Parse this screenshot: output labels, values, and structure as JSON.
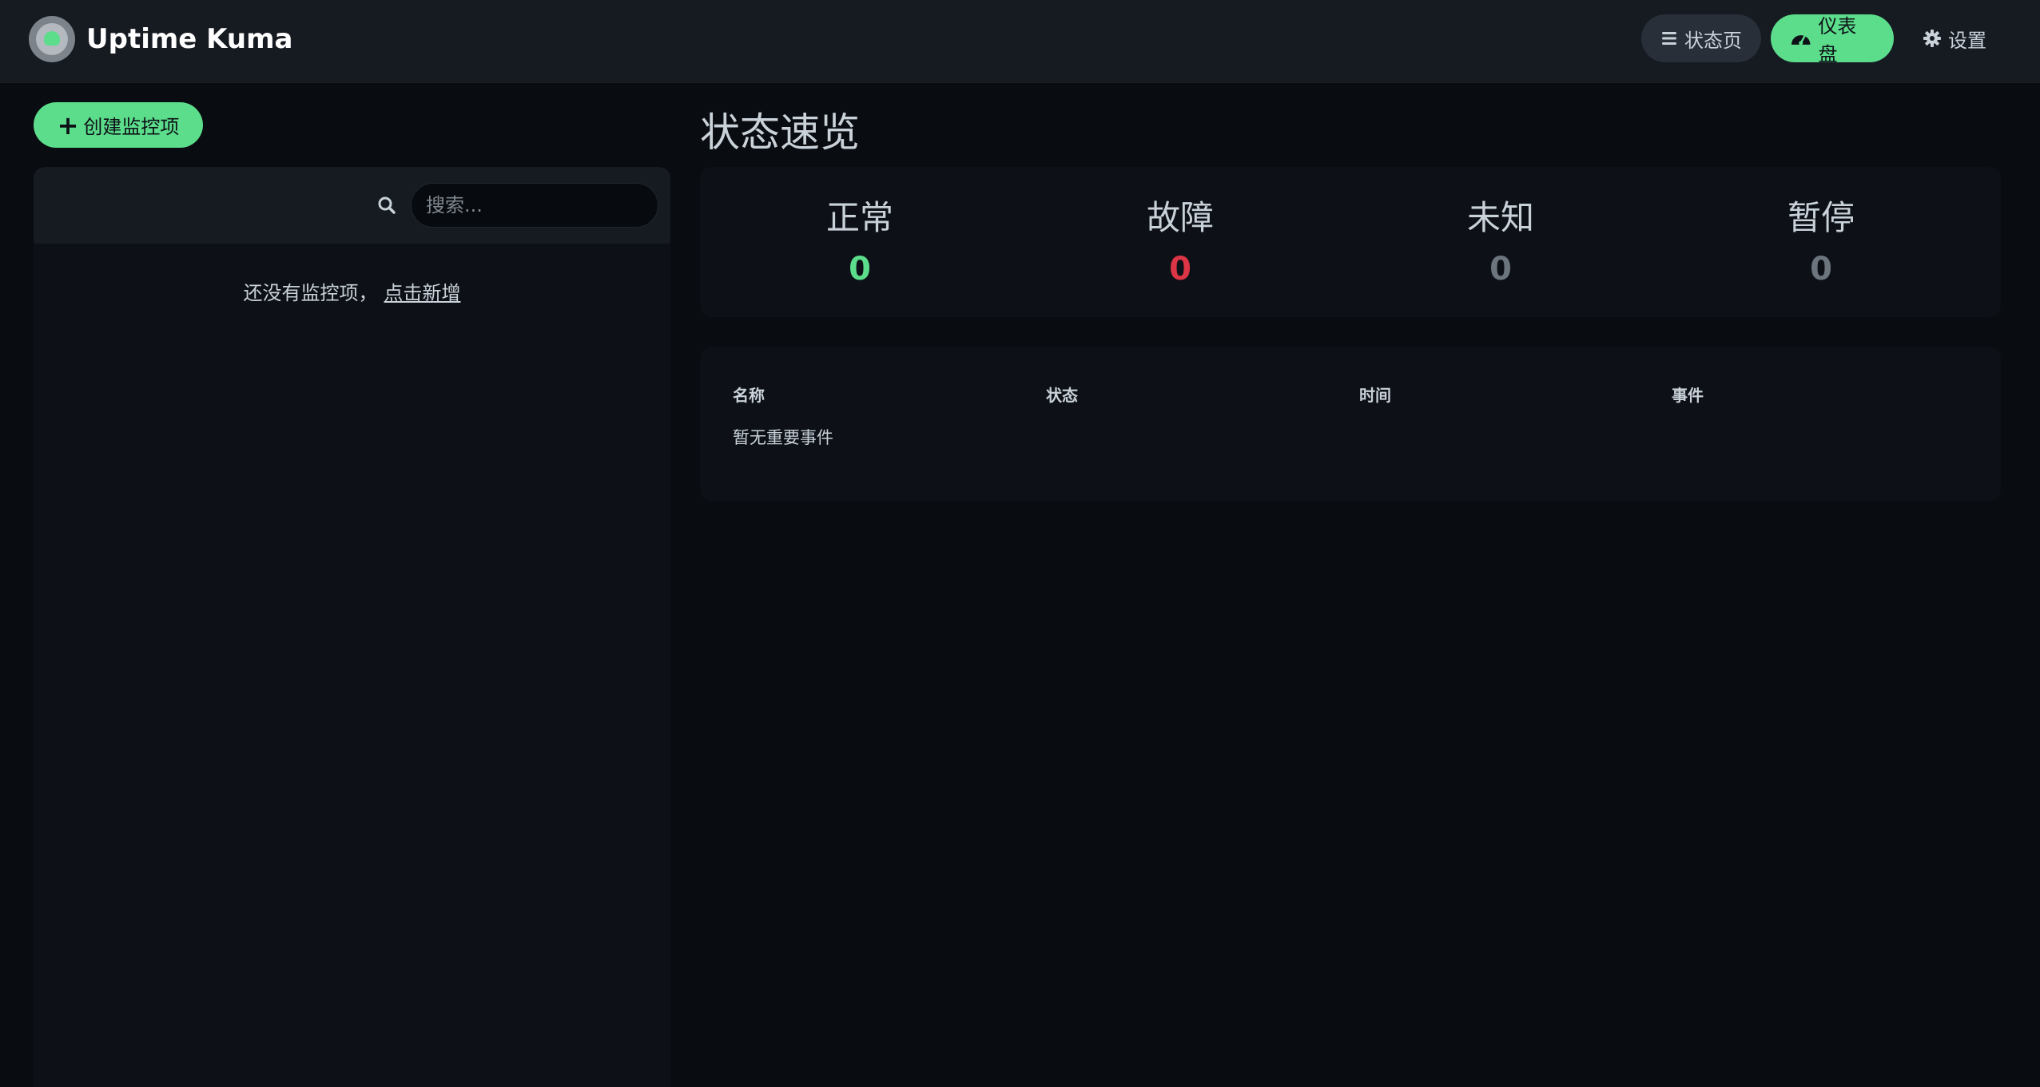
{
  "brand": {
    "name": "Uptime Kuma"
  },
  "nav": {
    "status_page": "状态页",
    "dashboard": "仪表盘",
    "settings": "设置"
  },
  "sidebar": {
    "create_button": "创建监控项",
    "search_placeholder": "搜索...",
    "empty_text": "还没有监控项，",
    "empty_link": "点击新增"
  },
  "main": {
    "title": "状态速览",
    "stats": [
      {
        "label": "正常",
        "value": "0",
        "color": "#5cdd8b"
      },
      {
        "label": "故障",
        "value": "0",
        "color": "#dc3545"
      },
      {
        "label": "未知",
        "value": "0",
        "color": "#6c757d"
      },
      {
        "label": "暂停",
        "value": "0",
        "color": "#6c757d"
      }
    ],
    "events": {
      "columns": [
        "名称",
        "状态",
        "时间",
        "事件"
      ],
      "empty": "暂无重要事件"
    }
  },
  "colors": {
    "accent": "#5cdd8b",
    "background": "#090c10",
    "panel": "#0d1117",
    "header": "#161b22"
  }
}
